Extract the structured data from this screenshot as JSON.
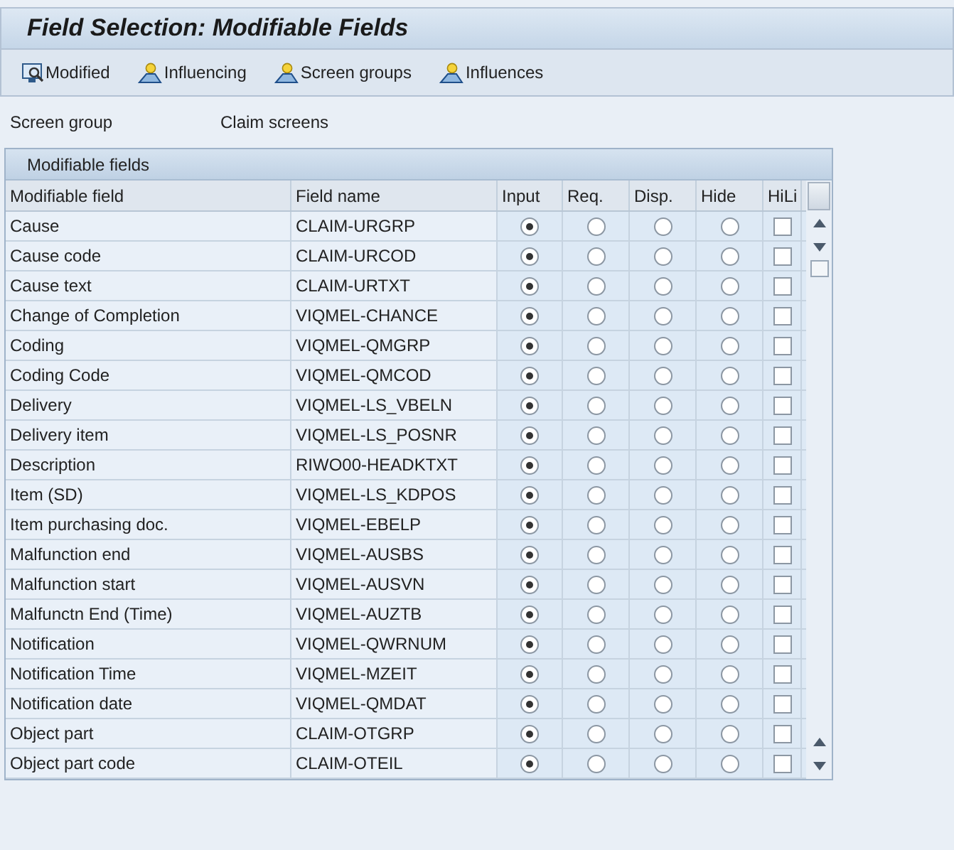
{
  "window": {
    "title": "Field Selection: Modifiable Fields"
  },
  "toolbar": [
    {
      "label": "Modified"
    },
    {
      "label": "Influencing"
    },
    {
      "label": "Screen groups"
    },
    {
      "label": "Influences"
    }
  ],
  "screen_group": {
    "label": "Screen group",
    "value": "Claim screens"
  },
  "table": {
    "title": "Modifiable fields",
    "columns": [
      {
        "label": "Modifiable field",
        "kind": "text"
      },
      {
        "label": "Field name",
        "kind": "text"
      },
      {
        "label": "Input",
        "kind": "radio"
      },
      {
        "label": "Req.",
        "kind": "radio"
      },
      {
        "label": "Disp.",
        "kind": "radio"
      },
      {
        "label": "Hide",
        "kind": "radio"
      },
      {
        "label": "HiLi",
        "kind": "check"
      }
    ],
    "rows": [
      {
        "field": "Cause",
        "name": "CLAIM-URGRP",
        "options": [
          {
            "selected": true
          },
          {
            "selected": false
          },
          {
            "selected": false
          },
          {
            "selected": false
          }
        ],
        "highlight": false
      },
      {
        "field": "Cause code",
        "name": "CLAIM-URCOD",
        "options": [
          {
            "selected": true
          },
          {
            "selected": false
          },
          {
            "selected": false
          },
          {
            "selected": false
          }
        ],
        "highlight": false
      },
      {
        "field": "Cause text",
        "name": "CLAIM-URTXT",
        "options": [
          {
            "selected": true
          },
          {
            "selected": false
          },
          {
            "selected": false
          },
          {
            "selected": false
          }
        ],
        "highlight": false
      },
      {
        "field": "Change of Completion",
        "name": "VIQMEL-CHANCE",
        "options": [
          {
            "selected": true
          },
          {
            "selected": false
          },
          {
            "selected": false
          },
          {
            "selected": false
          }
        ],
        "highlight": false
      },
      {
        "field": "Coding",
        "name": "VIQMEL-QMGRP",
        "options": [
          {
            "selected": true
          },
          {
            "selected": false
          },
          {
            "selected": false
          },
          {
            "selected": false
          }
        ],
        "highlight": false
      },
      {
        "field": "Coding Code",
        "name": "VIQMEL-QMCOD",
        "options": [
          {
            "selected": true
          },
          {
            "selected": false
          },
          {
            "selected": false
          },
          {
            "selected": false
          }
        ],
        "highlight": false
      },
      {
        "field": "Delivery",
        "name": "VIQMEL-LS_VBELN",
        "options": [
          {
            "selected": true
          },
          {
            "selected": false
          },
          {
            "selected": false
          },
          {
            "selected": false
          }
        ],
        "highlight": false
      },
      {
        "field": "Delivery item",
        "name": "VIQMEL-LS_POSNR",
        "options": [
          {
            "selected": true
          },
          {
            "selected": false
          },
          {
            "selected": false
          },
          {
            "selected": false
          }
        ],
        "highlight": false
      },
      {
        "field": "Description",
        "name": "RIWO00-HEADKTXT",
        "options": [
          {
            "selected": true
          },
          {
            "selected": false
          },
          {
            "selected": false
          },
          {
            "selected": false
          }
        ],
        "highlight": false
      },
      {
        "field": "Item (SD)",
        "name": "VIQMEL-LS_KDPOS",
        "options": [
          {
            "selected": true
          },
          {
            "selected": false
          },
          {
            "selected": false
          },
          {
            "selected": false
          }
        ],
        "highlight": false
      },
      {
        "field": "Item purchasing doc.",
        "name": "VIQMEL-EBELP",
        "options": [
          {
            "selected": true
          },
          {
            "selected": false
          },
          {
            "selected": false
          },
          {
            "selected": false
          }
        ],
        "highlight": false
      },
      {
        "field": "Malfunction end",
        "name": "VIQMEL-AUSBS",
        "options": [
          {
            "selected": true
          },
          {
            "selected": false
          },
          {
            "selected": false
          },
          {
            "selected": false
          }
        ],
        "highlight": false
      },
      {
        "field": "Malfunction start",
        "name": "VIQMEL-AUSVN",
        "options": [
          {
            "selected": true
          },
          {
            "selected": false
          },
          {
            "selected": false
          },
          {
            "selected": false
          }
        ],
        "highlight": false
      },
      {
        "field": "Malfunctn End (Time)",
        "name": "VIQMEL-AUZTB",
        "options": [
          {
            "selected": true
          },
          {
            "selected": false
          },
          {
            "selected": false
          },
          {
            "selected": false
          }
        ],
        "highlight": false
      },
      {
        "field": "Notification",
        "name": "VIQMEL-QWRNUM",
        "options": [
          {
            "selected": true
          },
          {
            "selected": false
          },
          {
            "selected": false
          },
          {
            "selected": false
          }
        ],
        "highlight": false
      },
      {
        "field": "Notification Time",
        "name": "VIQMEL-MZEIT",
        "options": [
          {
            "selected": true
          },
          {
            "selected": false
          },
          {
            "selected": false
          },
          {
            "selected": false
          }
        ],
        "highlight": false
      },
      {
        "field": "Notification date",
        "name": "VIQMEL-QMDAT",
        "options": [
          {
            "selected": true
          },
          {
            "selected": false
          },
          {
            "selected": false
          },
          {
            "selected": false
          }
        ],
        "highlight": false
      },
      {
        "field": "Object part",
        "name": "CLAIM-OTGRP",
        "options": [
          {
            "selected": true
          },
          {
            "selected": false
          },
          {
            "selected": false
          },
          {
            "selected": false
          }
        ],
        "highlight": false
      },
      {
        "field": "Object part code",
        "name": "CLAIM-OTEIL",
        "options": [
          {
            "selected": true
          },
          {
            "selected": false
          },
          {
            "selected": false
          },
          {
            "selected": false
          }
        ],
        "highlight": false
      }
    ]
  }
}
